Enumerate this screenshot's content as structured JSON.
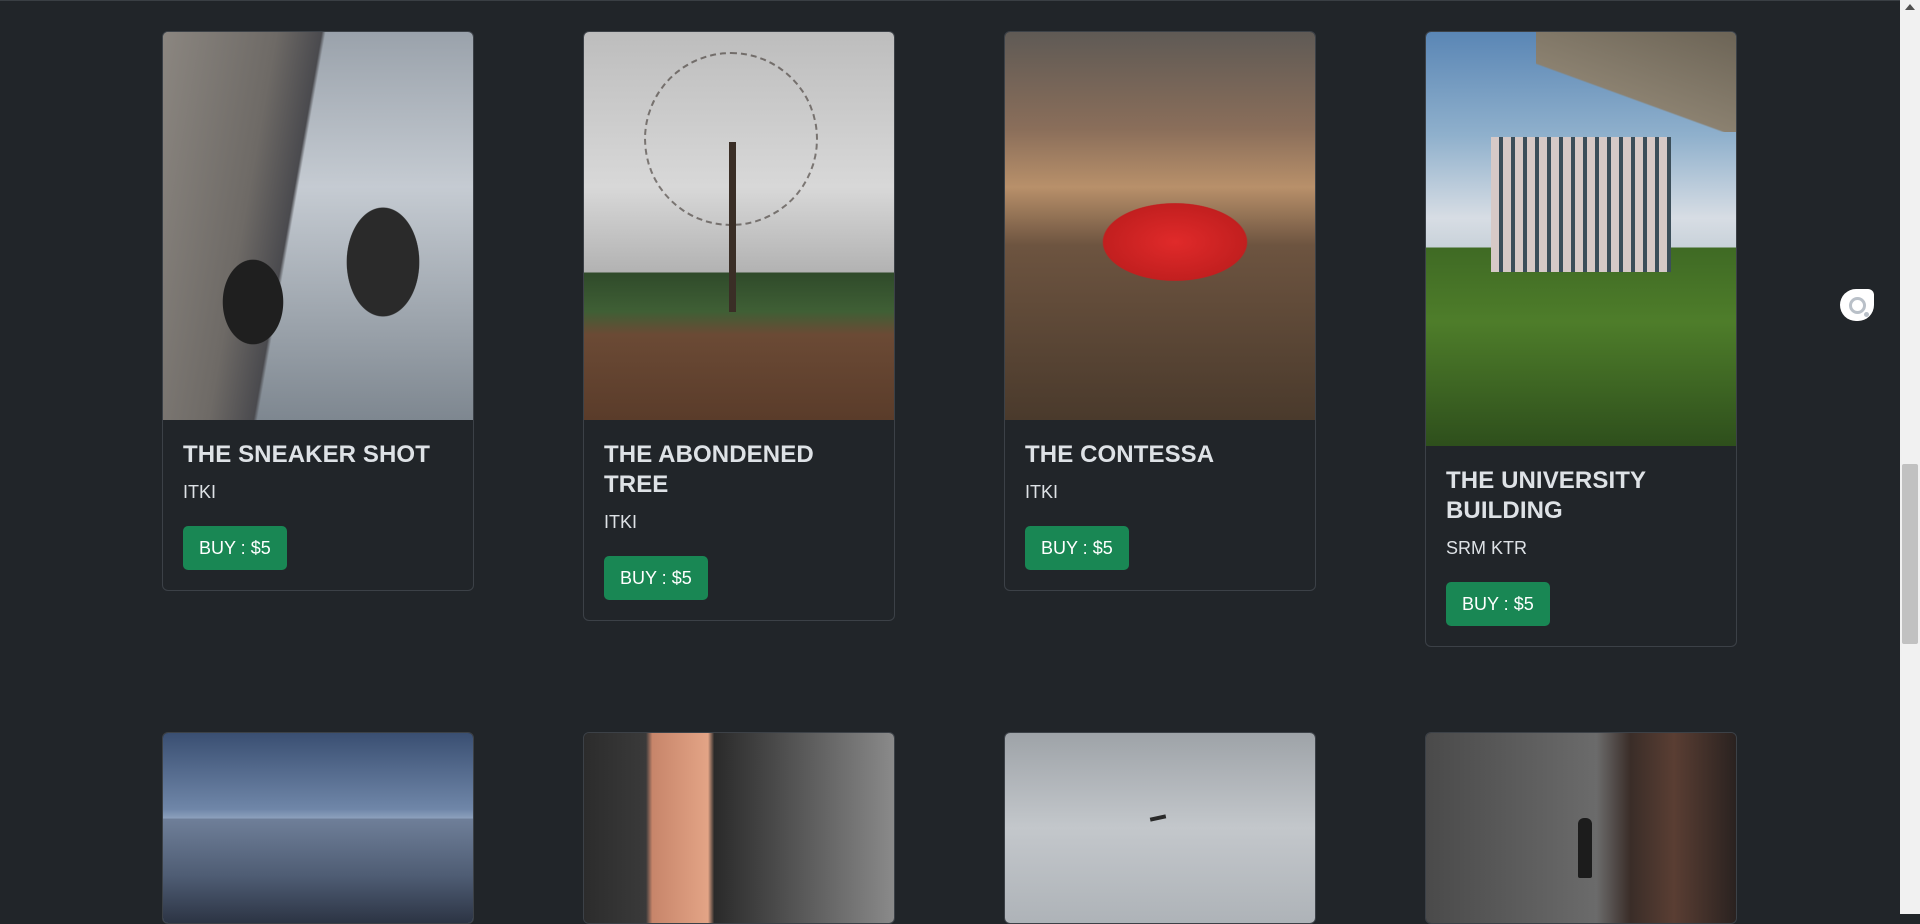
{
  "products": [
    {
      "title": "THE SNEAKER SHOT",
      "author": "ITKI",
      "buy_label": "BUY : $5",
      "image": "sneaker-photo"
    },
    {
      "title": "THE ABONDENED TREE",
      "author": "ITKI",
      "buy_label": "BUY : $5",
      "image": "tree-photo"
    },
    {
      "title": "THE CONTESSA",
      "author": "ITKI",
      "buy_label": "BUY : $5",
      "image": "red-car-photo"
    },
    {
      "title": "THE UNIVERSITY BUILDING",
      "author": "SRM KTR",
      "buy_label": "BUY : $5",
      "image": "university-building-photo"
    },
    {
      "image": "city-skyline-photo"
    },
    {
      "image": "balcony-photo"
    },
    {
      "image": "airplane-sky-photo"
    },
    {
      "image": "hooded-man-photo"
    }
  ],
  "colors": {
    "background": "#212529",
    "button": "#198754",
    "card_border": "#3c4147"
  }
}
